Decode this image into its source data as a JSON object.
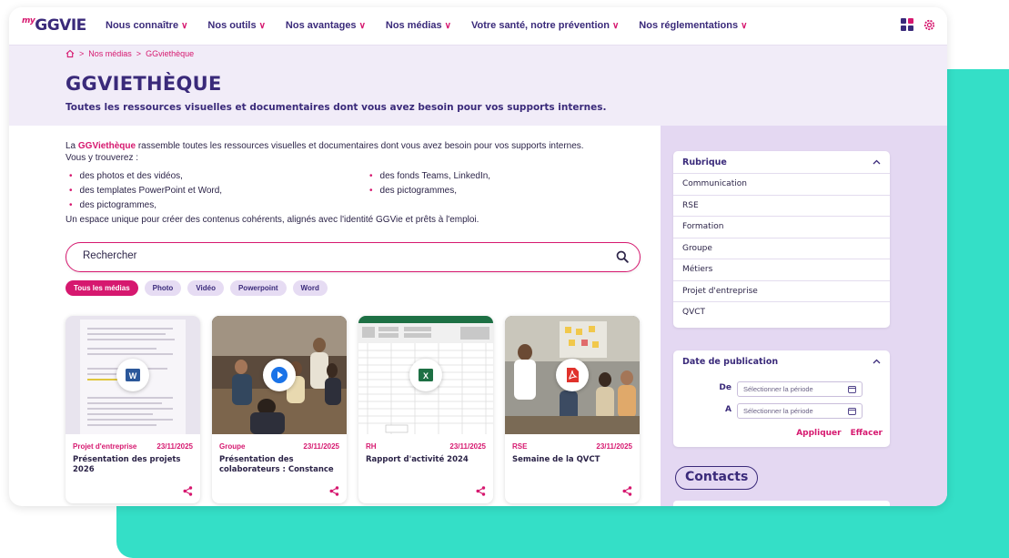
{
  "logo": {
    "prefix": "my",
    "name": "GGVIE"
  },
  "nav": {
    "items": [
      "Nous connaître",
      "Nos outils",
      "Nos avantages",
      "Nos médias",
      "Votre santé, notre prévention",
      "Nos réglementations"
    ],
    "chevron": "∨"
  },
  "breadcrumb": {
    "sep1": ">",
    "level1": "Nos médias",
    "sep2": ">",
    "level2": "GGviethèque"
  },
  "header": {
    "title": "GGVIETHÈQUE",
    "subtitle": "Toutes les ressources visuelles et documentaires dont vous avez besoin pour vos supports internes."
  },
  "intro": {
    "lead_prefix": "La ",
    "brand": "GGViethèque",
    "lead_suffix": " rassemble toutes les ressources visuelles et documentaires dont vous avez besoin pour vos supports internes.",
    "line2": "Vous y trouverez :",
    "bullets": [
      "des photos et des vidéos,",
      "des fonds Teams, LinkedIn,",
      "des templates PowerPoint et Word,",
      "des pictogrammes,",
      "des pictogrammes,"
    ],
    "closing": "Un espace unique pour créer des contenus cohérents, alignés avec l'identité GGVie et prêts à  l'emploi."
  },
  "search": {
    "placeholder": "Rechercher"
  },
  "filters": [
    "Tous les médias",
    "Photo",
    "Vidéo",
    "Powerpoint",
    "Word"
  ],
  "cards": [
    {
      "category": "Projet d'entreprise",
      "date": "23/11/2025",
      "title": "Présentation des projets 2026",
      "file_icon": "word-icon",
      "badge_color": "#2b579a"
    },
    {
      "category": "Groupe",
      "date": "23/11/2025",
      "title": "Présentation des colaborateurs : Constance",
      "file_icon": "play-icon",
      "badge_color": "#1a73e8"
    },
    {
      "category": "RH",
      "date": "23/11/2025",
      "title": "Rapport d'activité 2024",
      "file_icon": "excel-icon",
      "badge_color": "#1d7044"
    },
    {
      "category": "RSE",
      "date": "23/11/2025",
      "title": "Semaine de la QVCT",
      "file_icon": "pdf-icon",
      "badge_color": "#e0322c"
    }
  ],
  "sidebar": {
    "rubrique": {
      "title": "Rubrique",
      "items": [
        "Communication",
        "RSE",
        "Formation",
        "Groupe",
        "Métiers",
        "Projet d'entreprise",
        "QVCT"
      ]
    },
    "date": {
      "title": "Date de publication",
      "from_label": "De",
      "to_label": "A",
      "from_placeholder": "Sélectionner la période",
      "to_placeholder": "Sélectionner la période",
      "apply": "Appliquer",
      "clear": "Effacer"
    },
    "contacts": "Contacts"
  },
  "colors": {
    "brand_pink": "#d6186f",
    "brand_navy": "#3a2a7a",
    "lavender": "#e4d8f2",
    "teal": "#34dfc7"
  }
}
